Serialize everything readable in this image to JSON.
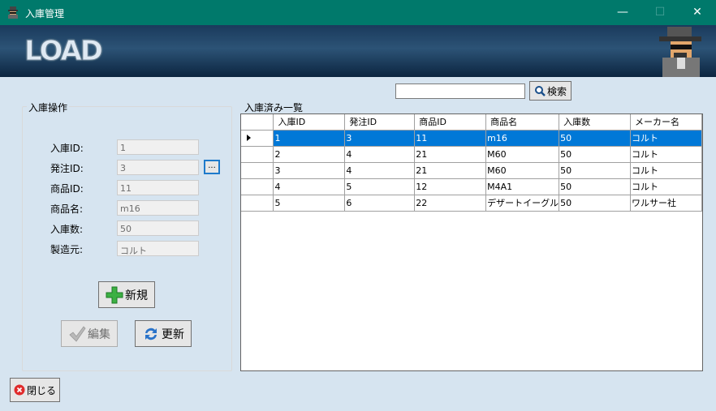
{
  "window": {
    "title": "入庫管理",
    "minimize": "—",
    "maximize": "☐",
    "close": "✕"
  },
  "banner": {
    "logo": "LOAD"
  },
  "search": {
    "value": "",
    "button_label": "検索"
  },
  "operations": {
    "group_title": "入庫操作",
    "fields": [
      {
        "label": "入庫ID:",
        "value": "1"
      },
      {
        "label": "発注ID:",
        "value": "3"
      },
      {
        "label": "商品ID:",
        "value": "11"
      },
      {
        "label": "商品名:",
        "value": "m16"
      },
      {
        "label": "入庫数:",
        "value": "50"
      },
      {
        "label": "製造元:",
        "value": "コルト"
      }
    ],
    "browse_label": "...",
    "new_label": "新規",
    "edit_label": "編集",
    "refresh_label": "更新"
  },
  "grid": {
    "title": "入庫済み一覧",
    "columns": [
      "入庫ID",
      "発注ID",
      "商品ID",
      "商品名",
      "入庫数",
      "メーカー名"
    ],
    "rows": [
      [
        "1",
        "3",
        "11",
        "m16",
        "50",
        "コルト"
      ],
      [
        "2",
        "4",
        "21",
        "M60",
        "50",
        "コルト"
      ],
      [
        "3",
        "4",
        "21",
        "M60",
        "50",
        "コルト"
      ],
      [
        "4",
        "5",
        "12",
        "M4A1",
        "50",
        "コルト"
      ],
      [
        "5",
        "6",
        "22",
        "デザートイーグル",
        "50",
        "ワルサー社"
      ]
    ],
    "selected_row": 0
  },
  "footer": {
    "close_label": "閉じる"
  },
  "colors": {
    "titlebar": "#00796b",
    "selection": "#0078d7",
    "background": "#d6e4f0"
  }
}
